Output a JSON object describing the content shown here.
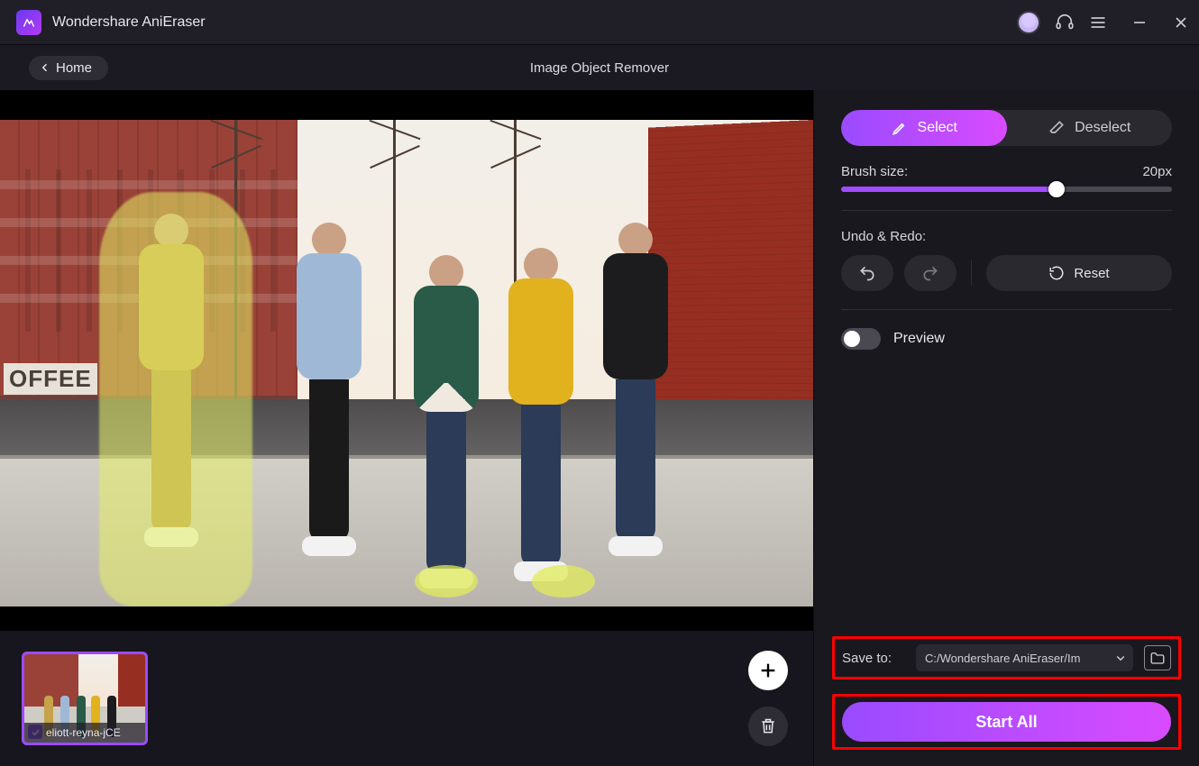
{
  "app": {
    "title": "Wondershare AniEraser"
  },
  "header": {
    "home_label": "Home",
    "page_title": "Image Object Remover"
  },
  "panel": {
    "select_label": "Select",
    "deselect_label": "Deselect",
    "brush_label": "Brush size:",
    "brush_value": "20px",
    "undo_label": "Undo & Redo:",
    "reset_label": "Reset",
    "preview_label": "Preview",
    "save_label": "Save to:",
    "save_path": "C:/Wondershare AniEraser/Im",
    "start_label": "Start All"
  },
  "thumb": {
    "caption": "eliott-reyna-jCE",
    "checked": true
  },
  "scene": {
    "coffee_sign": "OFFEE"
  }
}
